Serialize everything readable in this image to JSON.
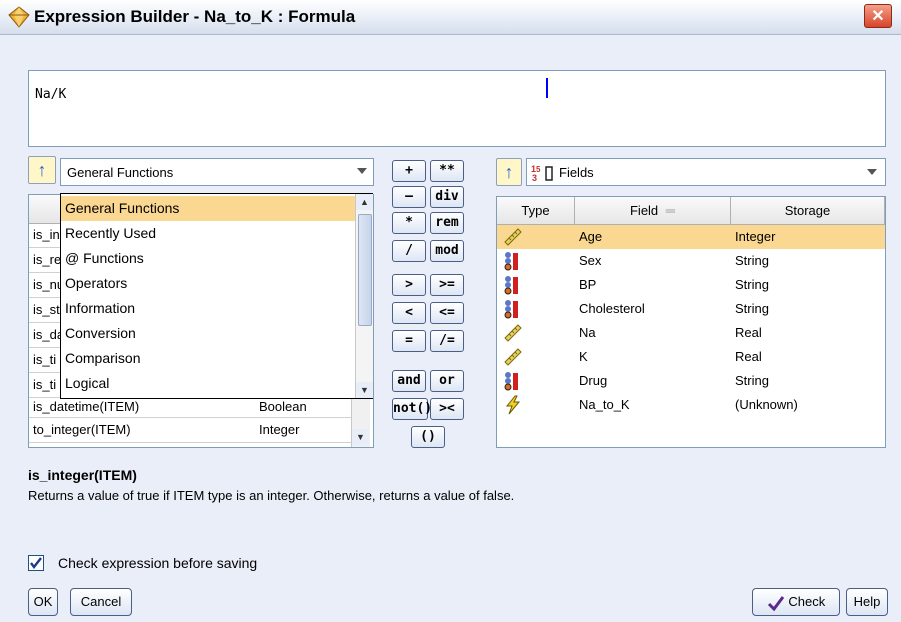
{
  "window": {
    "title": "Expression Builder - Na_to_K : Formula",
    "close_glyph": "✕"
  },
  "expression": {
    "text": "Na/K"
  },
  "functions_panel": {
    "category_selected": "General Functions",
    "dropdown_options": [
      "General Functions",
      "Recently Used",
      "@ Functions",
      "Operators",
      "Information",
      "Conversion",
      "Comparison",
      "Logical"
    ],
    "rows": [
      {
        "name": "is_in",
        "type": ""
      },
      {
        "name": "is_re",
        "type": ""
      },
      {
        "name": "is_nu",
        "type": ""
      },
      {
        "name": "is_st",
        "type": ""
      },
      {
        "name": "is_da",
        "type": ""
      },
      {
        "name": "is_ti",
        "type": ""
      },
      {
        "name": "is_ti",
        "type": ""
      },
      {
        "name": "is_datetime(ITEM)",
        "type": "Boolean"
      },
      {
        "name": "to_integer(ITEM)",
        "type": "Integer"
      }
    ]
  },
  "operators": [
    {
      "label": "+",
      "name": "plus"
    },
    {
      "label": "**",
      "name": "power"
    },
    {
      "label": "—",
      "name": "minus"
    },
    {
      "label": "div",
      "name": "div"
    },
    {
      "label": "*",
      "name": "multiply"
    },
    {
      "label": "rem",
      "name": "rem"
    },
    {
      "label": "/",
      "name": "divide"
    },
    {
      "label": "mod",
      "name": "mod"
    },
    {
      "label": ">",
      "name": "greater-than"
    },
    {
      "label": ">=",
      "name": "greater-equal"
    },
    {
      "label": "<",
      "name": "less-than"
    },
    {
      "label": "<=",
      "name": "less-equal"
    },
    {
      "label": "=",
      "name": "equal"
    },
    {
      "label": "/=",
      "name": "not-equal"
    },
    {
      "label": "and",
      "name": "and"
    },
    {
      "label": "or",
      "name": "or"
    },
    {
      "label": "not()",
      "name": "not"
    },
    {
      "label": "><",
      "name": "concat"
    },
    {
      "label": "()",
      "name": "parentheses"
    }
  ],
  "fields_panel": {
    "source_selected": "Fields",
    "columns": [
      "Type",
      "Field",
      "Storage"
    ],
    "rows": [
      {
        "type_icon": "continuous-ruler-icon",
        "field": "Age",
        "storage": "Integer"
      },
      {
        "type_icon": "flag-set-icon",
        "field": "Sex",
        "storage": "String"
      },
      {
        "type_icon": "flag-set-icon",
        "field": "BP",
        "storage": "String"
      },
      {
        "type_icon": "flag-set-icon",
        "field": "Cholesterol",
        "storage": "String"
      },
      {
        "type_icon": "continuous-ruler-icon",
        "field": "Na",
        "storage": "Real"
      },
      {
        "type_icon": "continuous-ruler-icon",
        "field": "K",
        "storage": "Real"
      },
      {
        "type_icon": "flag-set-icon",
        "field": "Drug",
        "storage": "String"
      },
      {
        "type_icon": "lightning-icon",
        "field": "Na_to_K",
        "storage": "(Unknown)"
      }
    ]
  },
  "description": {
    "title": "is_integer(ITEM)",
    "text": "Returns a value of true if ITEM type is an integer. Otherwise, returns a value of false."
  },
  "check_expression": {
    "label": "Check expression before saving",
    "checked": true
  },
  "buttons": {
    "ok": "OK",
    "cancel": "Cancel",
    "check": "Check",
    "help": "Help"
  },
  "colors": {
    "selection": "#fbd891",
    "background": "#e9eef8"
  }
}
